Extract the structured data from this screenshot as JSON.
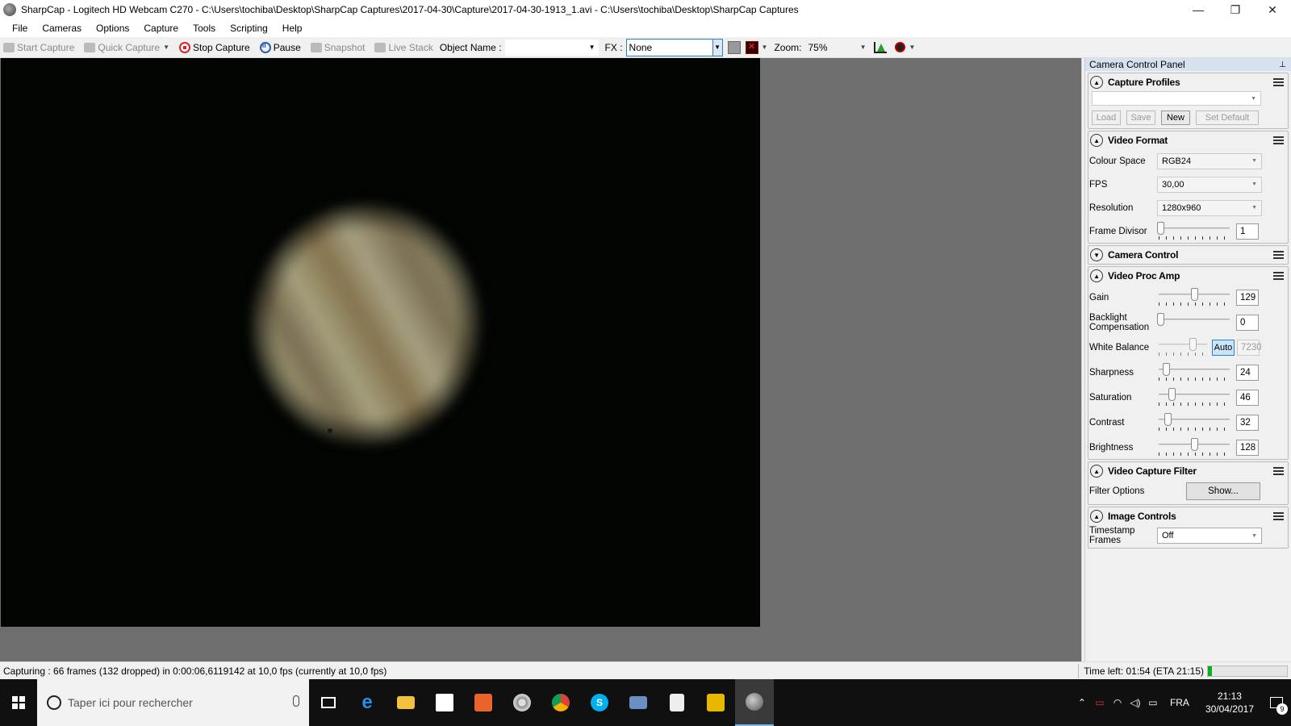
{
  "window": {
    "title": "SharpCap - Logitech HD Webcam C270 - C:\\Users\\tochiba\\Desktop\\SharpCap Captures\\2017-04-30\\Capture\\2017-04-30-1913_1.avi - C:\\Users\\tochiba\\Desktop\\SharpCap Captures",
    "minimize": "—",
    "restore": "❐",
    "close": "✕"
  },
  "menu": [
    "File",
    "Cameras",
    "Options",
    "Capture",
    "Tools",
    "Scripting",
    "Help"
  ],
  "toolbar": {
    "start_capture": "Start Capture",
    "quick_capture": "Quick Capture",
    "stop_capture": "Stop Capture",
    "pause": "Pause",
    "snapshot": "Snapshot",
    "live_stack": "Live Stack",
    "object_name_label": "Object Name :",
    "object_name_value": "",
    "fx_label": "FX :",
    "fx_value": "None",
    "zoom_label": "Zoom:",
    "zoom_value": "75%"
  },
  "panel": {
    "title": "Camera Control Panel",
    "capture_profiles": {
      "title": "Capture Profiles",
      "profile_value": "",
      "load": "Load",
      "save": "Save",
      "new": "New",
      "set_default": "Set Default"
    },
    "video_format": {
      "title": "Video Format",
      "colour_space_label": "Colour Space",
      "colour_space_value": "RGB24",
      "fps_label": "FPS",
      "fps_value": "30,00",
      "resolution_label": "Resolution",
      "resolution_value": "1280x960",
      "frame_divisor_label": "Frame Divisor",
      "frame_divisor_value": "1"
    },
    "camera_control": {
      "title": "Camera Control"
    },
    "video_proc_amp": {
      "title": "Video Proc Amp",
      "gain_label": "Gain",
      "gain_value": "129",
      "backlight_label_1": "Backlight",
      "backlight_label_2": "Compensation",
      "backlight_value": "0",
      "white_balance_label": "White Balance",
      "white_balance_auto": "Auto",
      "white_balance_value": "7230",
      "sharpness_label": "Sharpness",
      "sharpness_value": "24",
      "saturation_label": "Saturation",
      "saturation_value": "46",
      "contrast_label": "Contrast",
      "contrast_value": "32",
      "brightness_label": "Brightness",
      "brightness_value": "128"
    },
    "video_capture_filter": {
      "title": "Video Capture Filter",
      "filter_options_label": "Filter Options",
      "show_button": "Show..."
    },
    "image_controls": {
      "title": "Image Controls",
      "timestamp_label_1": "Timestamp",
      "timestamp_label_2": "Frames",
      "timestamp_value": "Off"
    }
  },
  "status": {
    "left": "Capturing : 66 frames (132 dropped) in 0:00:06,6119142 at 10,0 fps  (currently at 10,0 fps)",
    "time_left": "Time left: 01:54 (ETA 21:15)",
    "progress_percent": 5
  },
  "taskbar": {
    "search_placeholder": "Taper ici pour rechercher",
    "language": "FRA",
    "time": "21:13",
    "date": "30/04/2017",
    "notification_count": "9"
  },
  "colors": {
    "accent": "#2a7fd4",
    "progress_fill": "#06b025",
    "panel_header": "#d6e2f0"
  }
}
